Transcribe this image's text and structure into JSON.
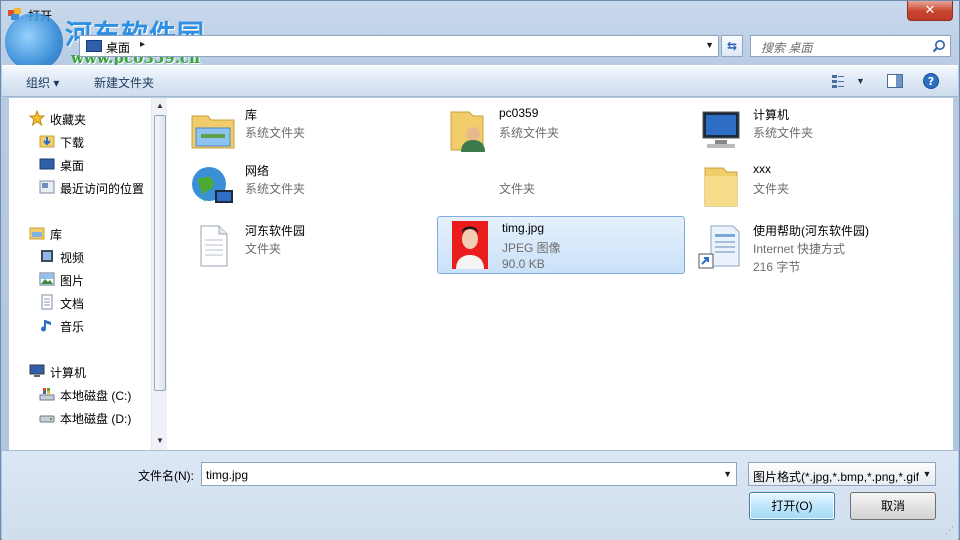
{
  "window": {
    "title": "打开",
    "close_label": "✕"
  },
  "watermark": {
    "title": "河东软件园",
    "url": "www.pc0359.cn"
  },
  "address": {
    "location": "桌面",
    "search_placeholder": "搜索 桌面"
  },
  "toolbar": {
    "organize": "组织 ▾",
    "new_folder": "新建文件夹"
  },
  "nav": {
    "favorites": {
      "label": "收藏夹",
      "items": [
        "下载",
        "桌面",
        "最近访问的位置"
      ]
    },
    "libraries": {
      "label": "库",
      "items": [
        "视频",
        "图片",
        "文档",
        "音乐"
      ]
    },
    "computer": {
      "label": "计算机",
      "items": [
        "本地磁盘 (C:)",
        "本地磁盘 (D:)"
      ]
    }
  },
  "files": [
    {
      "name": "库",
      "sub": "系统文件夹",
      "icon": "library-icon"
    },
    {
      "name": "pc0359",
      "sub": "系统文件夹",
      "icon": "user-folder-icon"
    },
    {
      "name": "计算机",
      "sub": "系统文件夹",
      "icon": "computer-icon"
    },
    {
      "name": "网络",
      "sub": "系统文件夹",
      "icon": "network-icon"
    },
    {
      "name": "",
      "sub": "文件夹",
      "icon": "folder-icon"
    },
    {
      "name": "xxx",
      "sub": "文件夹",
      "icon": "folder-icon"
    },
    {
      "name": "河东软件园",
      "sub": "文件夹",
      "icon": "text-file-icon"
    },
    {
      "name": "timg.jpg",
      "sub": "JPEG 图像",
      "sub2": "90.0 KB",
      "icon": "photo-thumbnail"
    },
    {
      "name": "使用帮助(河东软件园)",
      "sub": "Internet 快捷方式",
      "sub2": "216 字节",
      "icon": "internet-shortcut-icon"
    }
  ],
  "bottom": {
    "filename_label": "文件名(N):",
    "filename_value": "timg.jpg",
    "filetype_value": "图片格式(*.jpg,*.bmp,*.png,*.gif)",
    "open_label": "打开(O)",
    "cancel_label": "取消"
  },
  "colors": {
    "selection": "#c9e1f8",
    "accent": "#3c7fb1",
    "close": "#c7432f"
  }
}
